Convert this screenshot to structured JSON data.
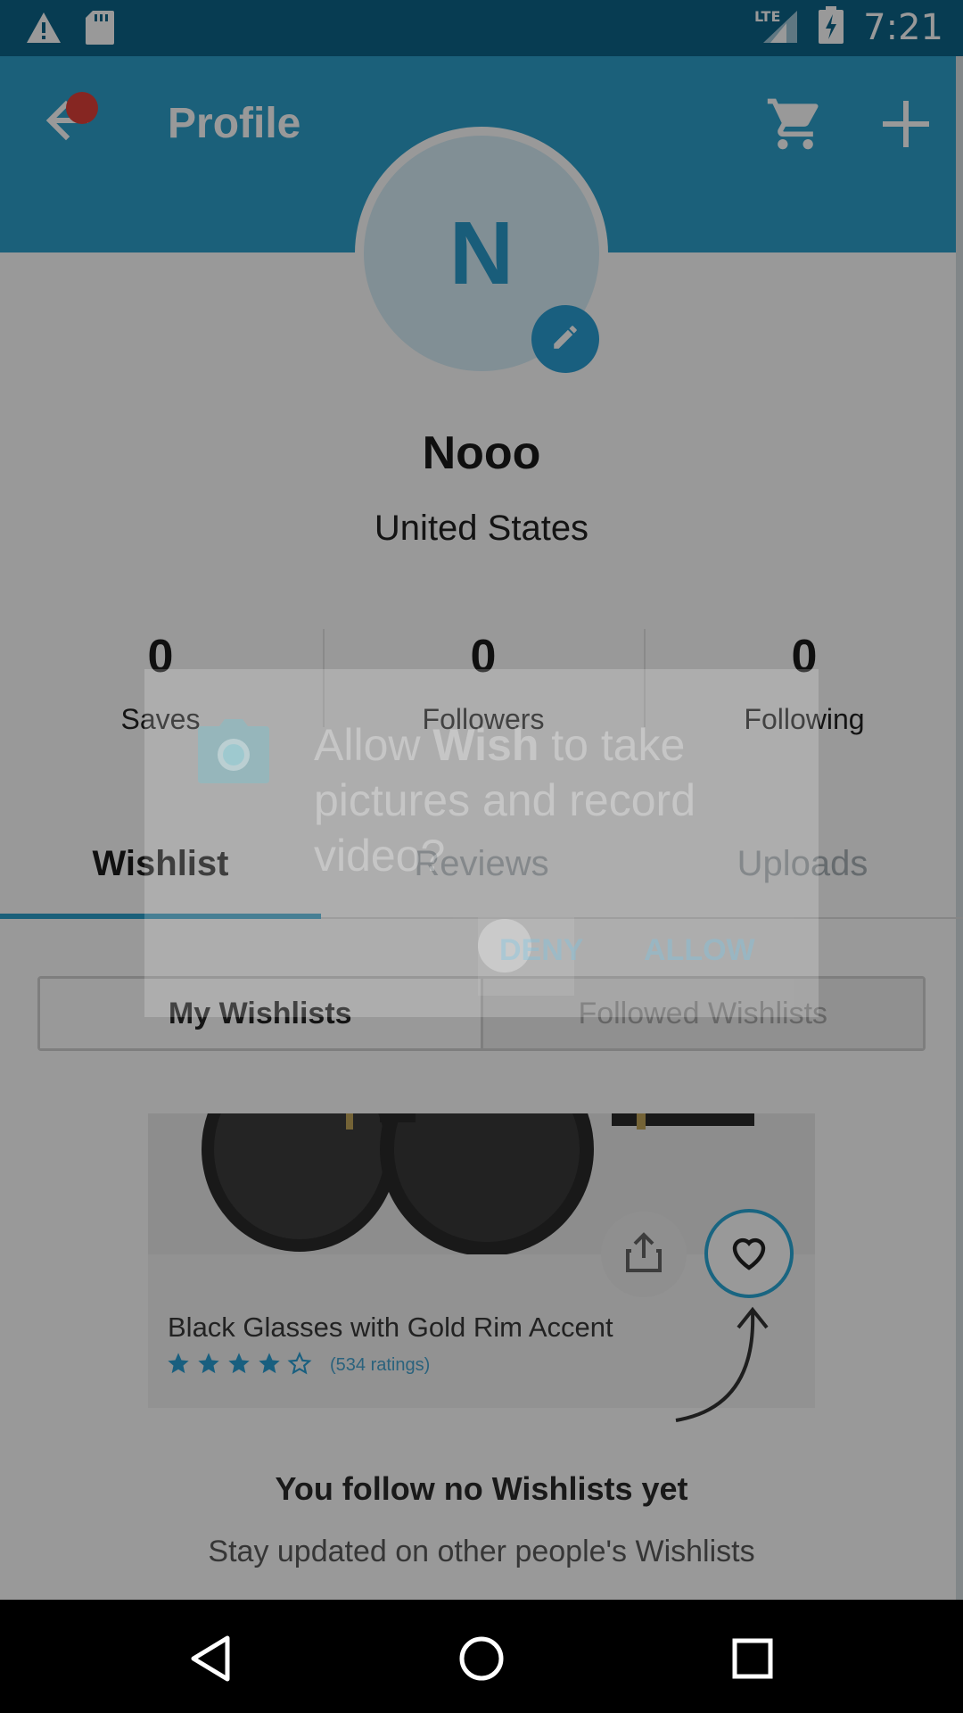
{
  "status_bar": {
    "time": "7:21",
    "network": "LTE",
    "icons": [
      "warning-icon",
      "sd-card-icon",
      "signal-icon",
      "battery-charging-icon"
    ]
  },
  "app_bar": {
    "title": "Profile",
    "icons": [
      "back-arrow-icon",
      "cart-icon",
      "plus-icon"
    ],
    "color": "#2ea1cc"
  },
  "profile": {
    "initial": "N",
    "name": "Nooo",
    "location": "United States"
  },
  "stats": [
    {
      "count": "0",
      "label": "Saves"
    },
    {
      "count": "0",
      "label": "Followers"
    },
    {
      "count": "0",
      "label": "Following"
    }
  ],
  "tabs": [
    {
      "label": "Wishlist",
      "active": true
    },
    {
      "label": "Reviews",
      "active": false
    },
    {
      "label": "Uploads",
      "active": false
    }
  ],
  "segmented": {
    "my_wishlists": "My Wishlists",
    "followed_wishlists": "Followed Wishlists"
  },
  "example_card": {
    "product_title": "Black Glasses with Gold Rim Accent",
    "stars": 4,
    "ratings_text": "(534 ratings)"
  },
  "empty_state": {
    "title": "You follow no Wishlists yet",
    "subtitle": "Stay updated on other people's Wishlists"
  },
  "dialog": {
    "message_prefix": "Allow ",
    "app_name": "Wish",
    "message_suffix": " to take pictures and record video?",
    "deny_label": "DENY",
    "allow_label": "ALLOW"
  },
  "nav_bar": {
    "icons": [
      "back-triangle-icon",
      "home-circle-icon",
      "recents-square-icon"
    ]
  }
}
